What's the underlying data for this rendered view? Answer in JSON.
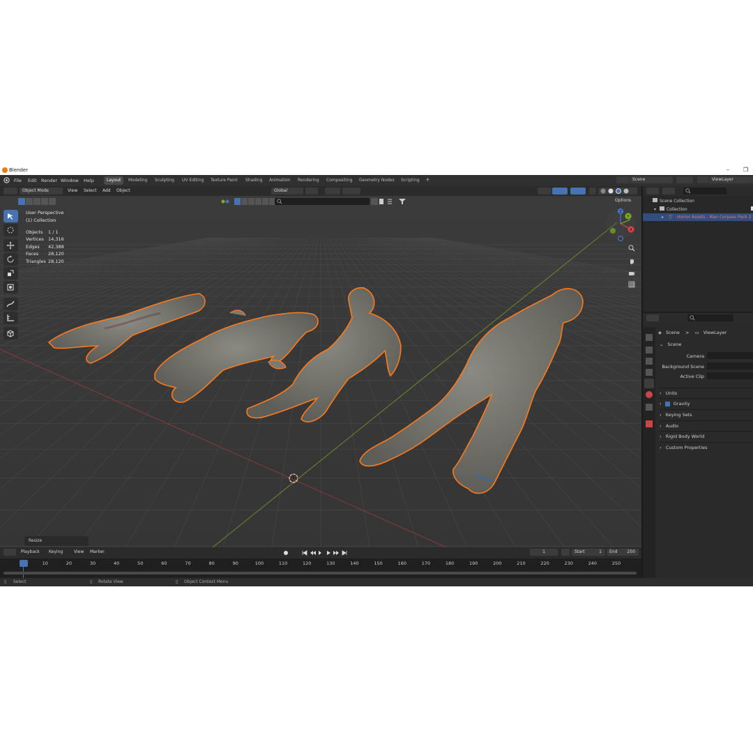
{
  "window": {
    "title": "Blender",
    "min_glyph": "–",
    "max_glyph": "❐"
  },
  "menu": [
    "File",
    "Edit",
    "Render",
    "Window",
    "Help"
  ],
  "workspaces": [
    {
      "label": "Layout",
      "active": true
    },
    {
      "label": "Modeling"
    },
    {
      "label": "Sculpting"
    },
    {
      "label": "UV Editing"
    },
    {
      "label": "Texture Paint"
    },
    {
      "label": "Shading"
    },
    {
      "label": "Animation"
    },
    {
      "label": "Rendering"
    },
    {
      "label": "Compositing"
    },
    {
      "label": "Geometry Nodes"
    },
    {
      "label": "Scripting"
    }
  ],
  "add_workspace": "+",
  "scene_selector": {
    "value": "Scene"
  },
  "viewlayer_selector": {
    "value": "ViewLayer"
  },
  "viewport_header": {
    "mode": "Object Mode",
    "menus": [
      "View",
      "Select",
      "Add",
      "Object"
    ],
    "orientation": "Global",
    "options": "Options"
  },
  "viewport": {
    "perspective": "User Perspective",
    "collection": "(1) Collection",
    "stats": [
      {
        "label": "Objects",
        "value": "1 / 1"
      },
      {
        "label": "Vertices",
        "value": "14,316"
      },
      {
        "label": "Edges",
        "value": "42,388"
      },
      {
        "label": "Faces",
        "value": "28,120"
      },
      {
        "label": "Triangles",
        "value": "28,120"
      }
    ],
    "last_op": "Resize",
    "gizmo": {
      "x": "X",
      "y": "Y",
      "z": "Z"
    }
  },
  "timeline": {
    "menus": [
      "Playback",
      "Keying",
      "View",
      "Marker"
    ],
    "current_frame": "1",
    "start_label": "Start",
    "start": "1",
    "end_label": "End",
    "end": "250",
    "ticks": [
      "1",
      "10",
      "20",
      "30",
      "40",
      "50",
      "60",
      "70",
      "80",
      "90",
      "100",
      "110",
      "120",
      "130",
      "140",
      "150",
      "160",
      "170",
      "180",
      "190",
      "200",
      "210",
      "220",
      "230",
      "240",
      "250"
    ]
  },
  "status": [
    "Select",
    "Rotate View",
    "Object Context Menu"
  ],
  "outliner": {
    "scene_collection": "Scene Collection",
    "collection": "Collection",
    "object": "Horror Assets - Man Corpses Pack 2"
  },
  "properties": {
    "breadcrumb_scene": "Scene",
    "breadcrumb_sep": ">",
    "breadcrumb_layer": "ViewLayer",
    "panel_title": "Scene",
    "fields": [
      "Camera",
      "Background Scene",
      "Active Clip"
    ],
    "sections": [
      {
        "label": "Units"
      },
      {
        "label": "Gravity",
        "checked": true
      },
      {
        "label": "Keying Sets"
      },
      {
        "label": "Audio"
      },
      {
        "label": "Rigid Body World"
      },
      {
        "label": "Custom Properties"
      }
    ]
  },
  "colors": {
    "accent": "#4772b3",
    "selection": "#ff7a1a",
    "active_text": "#e8824b"
  }
}
